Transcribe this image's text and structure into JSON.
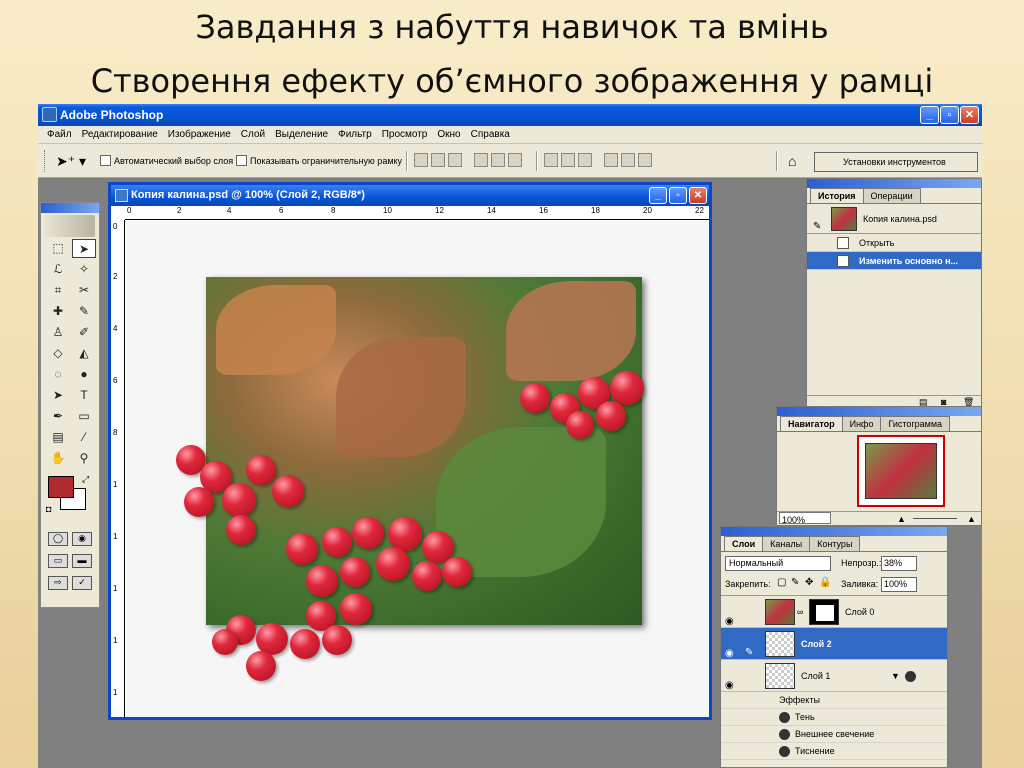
{
  "slide": {
    "title_line1": "Завдання з набуття навичок та вмінь",
    "title_line2": "Створення ефекту об’ємного зображення у рамці"
  },
  "app": {
    "title": "Adobe Photoshop",
    "menu": [
      "Файл",
      "Редактирование",
      "Изображение",
      "Слой",
      "Выделение",
      "Фильтр",
      "Просмотр",
      "Окно",
      "Справка"
    ]
  },
  "options": {
    "auto_select": "Автоматический выбор слоя",
    "show_bounds": "Показывать ограничительную рамку",
    "tool_presets": "Установки инструментов"
  },
  "document": {
    "title": "Копия калина.psd @ 100% (Слой 2, RGB/8*)",
    "ruler_top": [
      "0",
      "2",
      "4",
      "6",
      "8",
      "10",
      "12",
      "14",
      "16",
      "18",
      "20",
      "22"
    ],
    "ruler_left": [
      "0",
      "2",
      "4",
      "6",
      "8",
      "1",
      "1",
      "1",
      "1",
      "1"
    ]
  },
  "history": {
    "tabs": [
      "История",
      "Операции"
    ],
    "snapshot": "Копия калина.psd",
    "steps": [
      "Открыть",
      "Изменить основно н..."
    ]
  },
  "navigator": {
    "tabs": [
      "Навигатор",
      "Инфо",
      "Гистограмма"
    ],
    "zoom": "100%"
  },
  "layers": {
    "tabs": [
      "Слои",
      "Каналы",
      "Контуры"
    ],
    "blend_mode": "Нормальный",
    "opacity_label": "Непрозр.:",
    "opacity_value": "38%",
    "lock_label": "Закрепить:",
    "fill_label": "Заливка:",
    "fill_value": "100%",
    "items": [
      "Слой 0",
      "Слой 2",
      "Слой 1"
    ],
    "effects_label": "Эффекты",
    "effects": [
      "Тень",
      "Внешнее свечение",
      "Тиснение"
    ]
  },
  "colors": {
    "foreground": "#b02a2e",
    "xp_blue": "#0654d5",
    "selection": "#316ac5"
  }
}
